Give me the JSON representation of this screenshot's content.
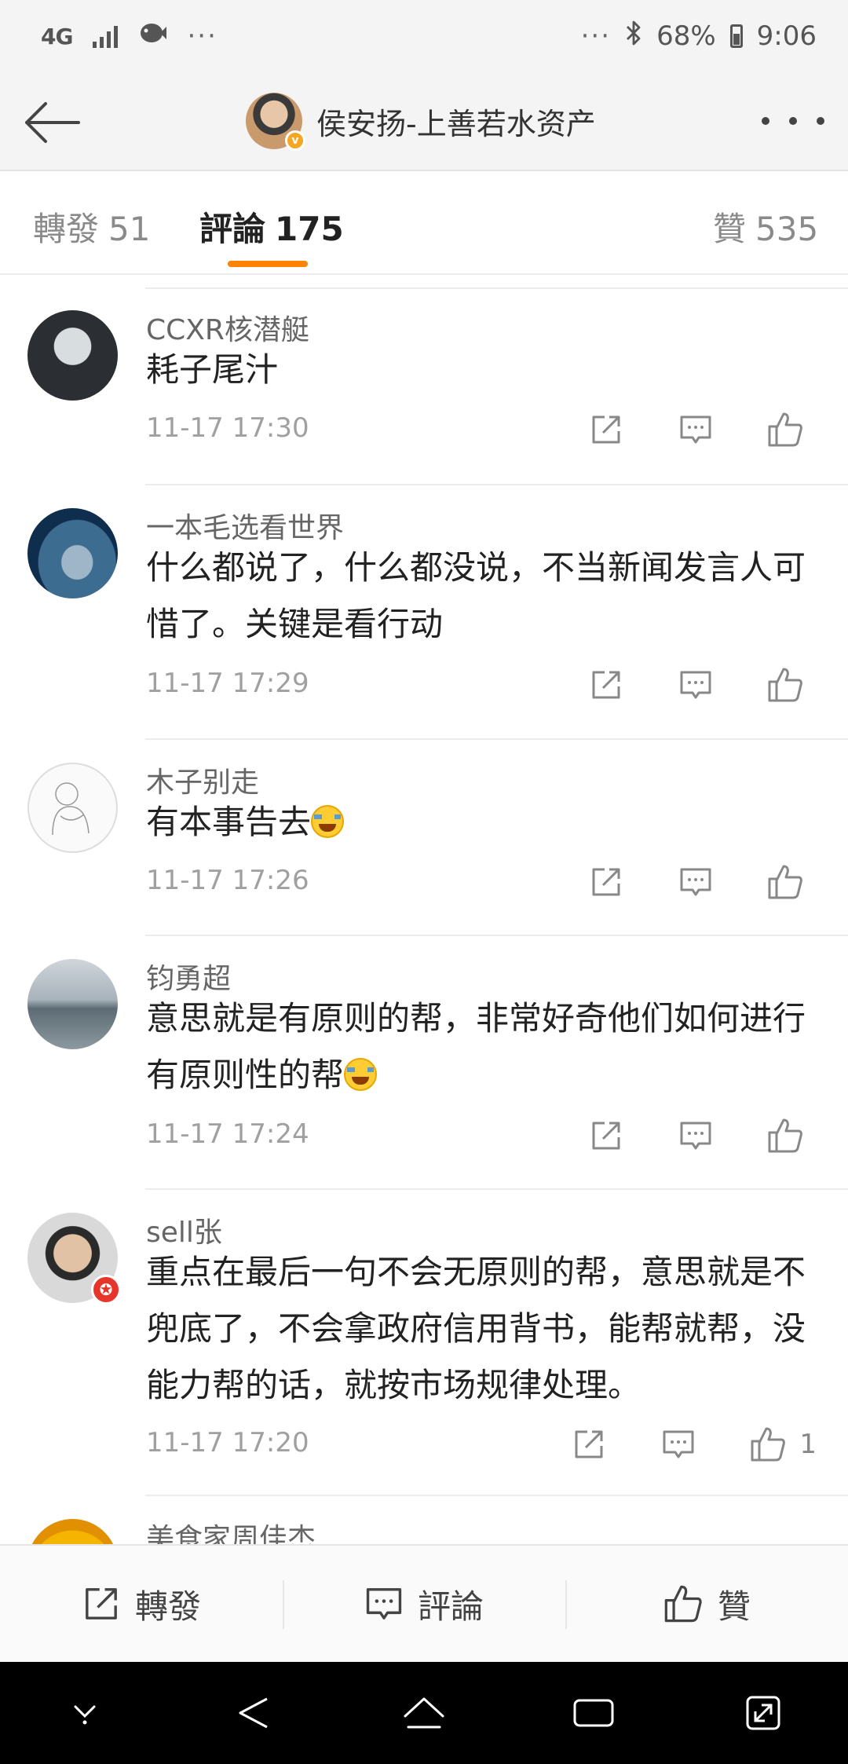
{
  "status_bar": {
    "network": "4G",
    "left_icons": [
      "signal-icon",
      "fish-icon"
    ],
    "left_more": "···",
    "right_more": "···",
    "bluetooth_icon": "bluetooth-icon",
    "battery_percent": "68%",
    "battery_level": 0.68,
    "time": "9:06"
  },
  "header": {
    "back_icon": "back-arrow-icon",
    "title": "侯安扬-上善若水资产",
    "verified_badge": "v",
    "more_icon": "more-dots-icon"
  },
  "tabs": [
    {
      "label": "轉發",
      "count": "51"
    },
    {
      "label": "評論",
      "count": "175",
      "active": true
    },
    {
      "label": "贊",
      "count": "535"
    }
  ],
  "accent_color": "#ff8200",
  "comments": [
    {
      "user": "CCXR核潜艇",
      "text": "耗子尾汁",
      "time": "11-17 17:30",
      "likes": ""
    },
    {
      "user": "一本毛选看世界",
      "text": "什么都说了，什么都没说，不当新闻发言人可惜了。关键是看行动",
      "time": "11-17 17:29",
      "likes": ""
    },
    {
      "user": "木子别走",
      "text": "有本事告去",
      "emoji": "crying-laughing-emoji",
      "time": "11-17 17:26",
      "likes": ""
    },
    {
      "user": "钧勇超",
      "text": "意思就是有原则的帮，非常好奇他们如何进行有原则性的帮",
      "emoji": "laughing-emoji",
      "time": "11-17 17:24",
      "likes": ""
    },
    {
      "user": "sell张",
      "text": "重点在最后一句不会无原则的帮，意思就是不兜底了，不会拿政府信用背书，能帮就帮，没能力帮的话，就按市场规律处理。",
      "time": "11-17 17:20",
      "likes": "1"
    },
    {
      "user": "美食家周佳杰",
      "text": "",
      "time": "",
      "likes": ""
    }
  ],
  "toolbar": {
    "repost_label": "轉發",
    "comment_label": "評論",
    "like_label": "贊"
  },
  "nav_bar": [
    "chevron-down-icon",
    "back-triangle-icon",
    "home-icon",
    "recents-icon",
    "expand-icon"
  ]
}
